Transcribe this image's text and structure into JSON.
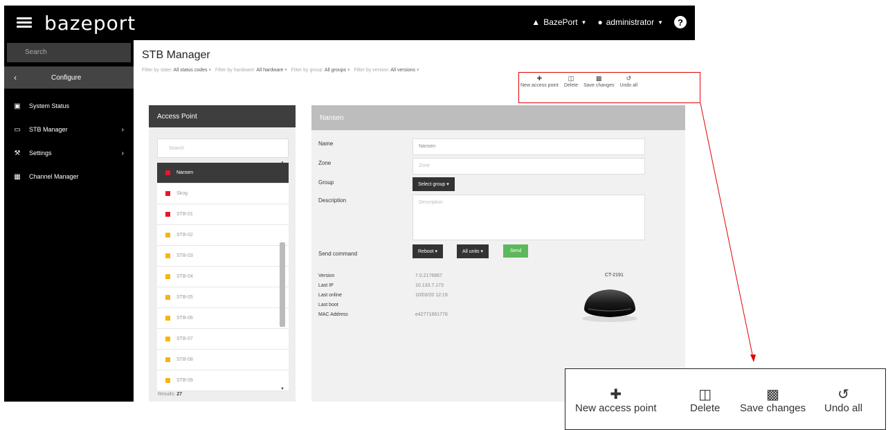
{
  "topbar": {
    "logo": "bazeport",
    "org_menu": "BazePort",
    "user_menu": "administrator",
    "help": "?"
  },
  "sidebar": {
    "search_placeholder": "Search",
    "configure_label": "Configure",
    "items": [
      {
        "label": "System Status",
        "icon": "dashboard-icon",
        "has_submenu": false
      },
      {
        "label": "STB Manager",
        "icon": "monitor-icon",
        "has_submenu": true
      },
      {
        "label": "Settings",
        "icon": "wrench-icon",
        "has_submenu": true
      },
      {
        "label": "Channel Manager",
        "icon": "grid-icon",
        "has_submenu": false
      }
    ]
  },
  "page": {
    "title": "STB Manager",
    "filters": [
      {
        "prefix": "Filter by state:",
        "value": "All status codes"
      },
      {
        "prefix": "Filter by hardware:",
        "value": "All hardware"
      },
      {
        "prefix": "Filter by group:",
        "value": "All groups"
      },
      {
        "prefix": "Filter by version:",
        "value": "All versions"
      }
    ]
  },
  "toolbar": {
    "new_access_point": "New access point",
    "delete": "Delete",
    "save_changes": "Save changes",
    "undo_all": "Undo all"
  },
  "access_point_panel": {
    "header": "Access Point",
    "search_placeholder": "Search",
    "rows": [
      {
        "label": "Nansen",
        "status": "red",
        "selected": true
      },
      {
        "label": "Skog",
        "status": "red",
        "selected": false
      },
      {
        "label": "STB-01",
        "status": "red",
        "selected": false
      },
      {
        "label": "STB-02",
        "status": "orange",
        "selected": false
      },
      {
        "label": "STB-03",
        "status": "orange",
        "selected": false
      },
      {
        "label": "STB-04",
        "status": "orange",
        "selected": false
      },
      {
        "label": "STB-05",
        "status": "orange",
        "selected": false
      },
      {
        "label": "STB-06",
        "status": "orange",
        "selected": false
      },
      {
        "label": "STB-07",
        "status": "orange",
        "selected": false
      },
      {
        "label": "STB-08",
        "status": "orange",
        "selected": false
      },
      {
        "label": "STB-09",
        "status": "orange",
        "selected": false
      }
    ],
    "results_label": "Results:",
    "results_count": "27"
  },
  "detail": {
    "header": "Nansen",
    "name_label": "Name",
    "name_value": "Nansen",
    "zone_label": "Zone",
    "zone_placeholder": "Zone",
    "group_label": "Group",
    "group_button": "Select group",
    "description_label": "Description",
    "description_placeholder": "Description",
    "send_command_label": "Send command",
    "reboot_button": "Reboot",
    "all_units_button": "All units",
    "send_button": "Send",
    "info": [
      {
        "label": "Version",
        "value": "7.0.2176867"
      },
      {
        "label": "Last IP",
        "value": "10.133.7.173"
      },
      {
        "label": "Last online",
        "value": "10/03/20 12:19"
      },
      {
        "label": "Last boot",
        "value": ""
      },
      {
        "label": "MAC Address",
        "value": "e42771661778"
      }
    ],
    "device_model": "CT-2191"
  },
  "colors": {
    "status_red": "#e8162c",
    "status_orange": "#f5b50f",
    "highlight_red": "#e00000",
    "send_green": "#5cb85c"
  }
}
